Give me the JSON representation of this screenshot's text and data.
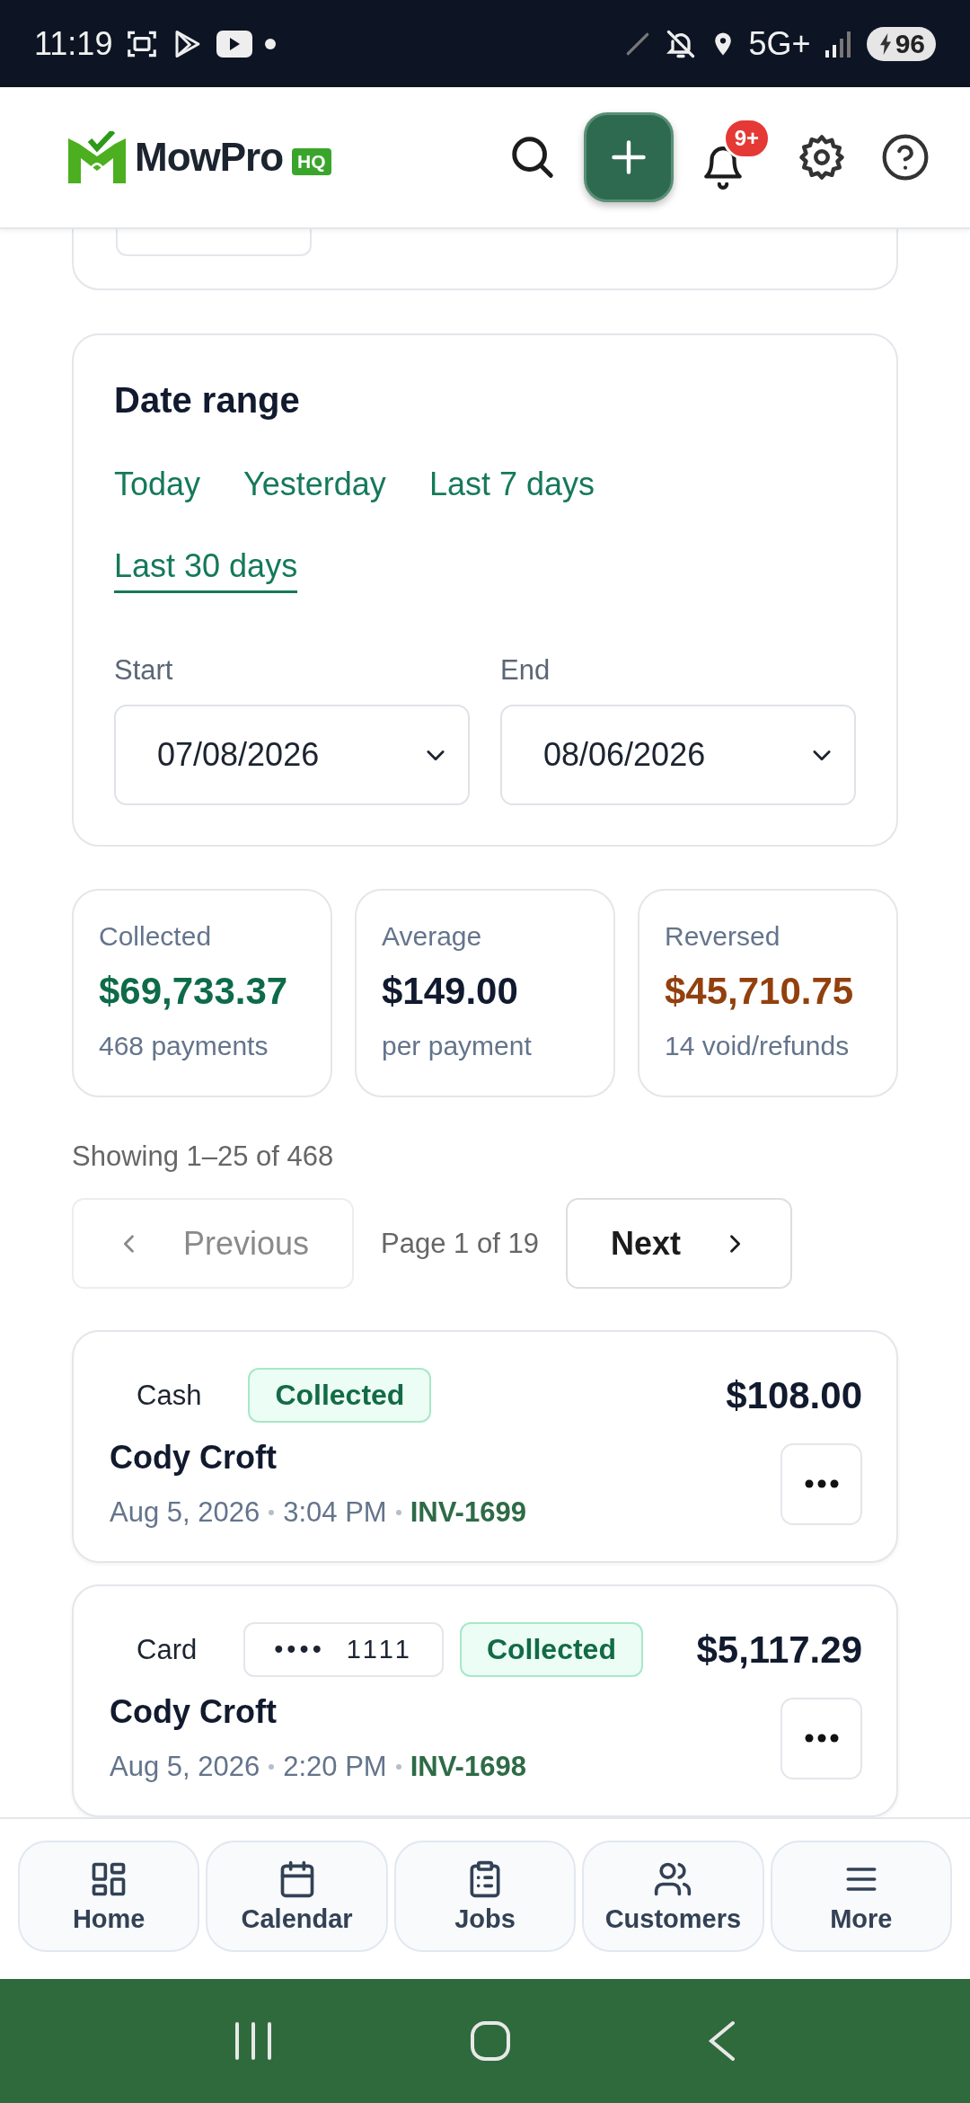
{
  "status_bar": {
    "time": "11:19",
    "network": "5G+",
    "battery": "96"
  },
  "header": {
    "brand": {
      "name": "MowPro",
      "badge": "HQ"
    },
    "notifications": {
      "badge": "9+"
    }
  },
  "date_range": {
    "title": "Date range",
    "presets": [
      {
        "label": "Today",
        "selected": false
      },
      {
        "label": "Yesterday",
        "selected": false
      },
      {
        "label": "Last 7 days",
        "selected": false
      },
      {
        "label": "Last 30 days",
        "selected": true
      }
    ],
    "start": {
      "label": "Start",
      "value": "07/08/2026"
    },
    "end": {
      "label": "End",
      "value": "08/06/2026"
    }
  },
  "stats": [
    {
      "label": "Collected",
      "value": "$69,733.37",
      "caption": "468 payments",
      "color": "#0e6b4a"
    },
    {
      "label": "Average",
      "value": "$149.00",
      "caption": "per payment",
      "color": "#111a2e"
    },
    {
      "label": "Reversed",
      "value": "$45,710.75",
      "caption": "14 void/refunds",
      "color": "#92400e"
    }
  ],
  "pagination": {
    "summary": "Showing 1–25 of 468",
    "previous": {
      "label": "Previous",
      "disabled": true
    },
    "page": "Page 1 of 19",
    "next": {
      "label": "Next",
      "disabled": false
    }
  },
  "payments": [
    {
      "method": "Cash",
      "status": "Collected",
      "amount": "$108.00",
      "customer": "Cody Croft",
      "date": "Aug 5, 2026",
      "time": "3:04 PM",
      "invoice": "INV-1699"
    },
    {
      "method": "Card",
      "card_mask": "••••",
      "card_last4": "1111",
      "status": "Collected",
      "amount": "$5,117.29",
      "customer": "Cody Croft",
      "date": "Aug 5, 2026",
      "time": "2:20 PM",
      "invoice": "INV-1698"
    }
  ],
  "bottom_nav": [
    {
      "label": "Home"
    },
    {
      "label": "Calendar"
    },
    {
      "label": "Jobs"
    },
    {
      "label": "Customers"
    },
    {
      "label": "More"
    }
  ]
}
